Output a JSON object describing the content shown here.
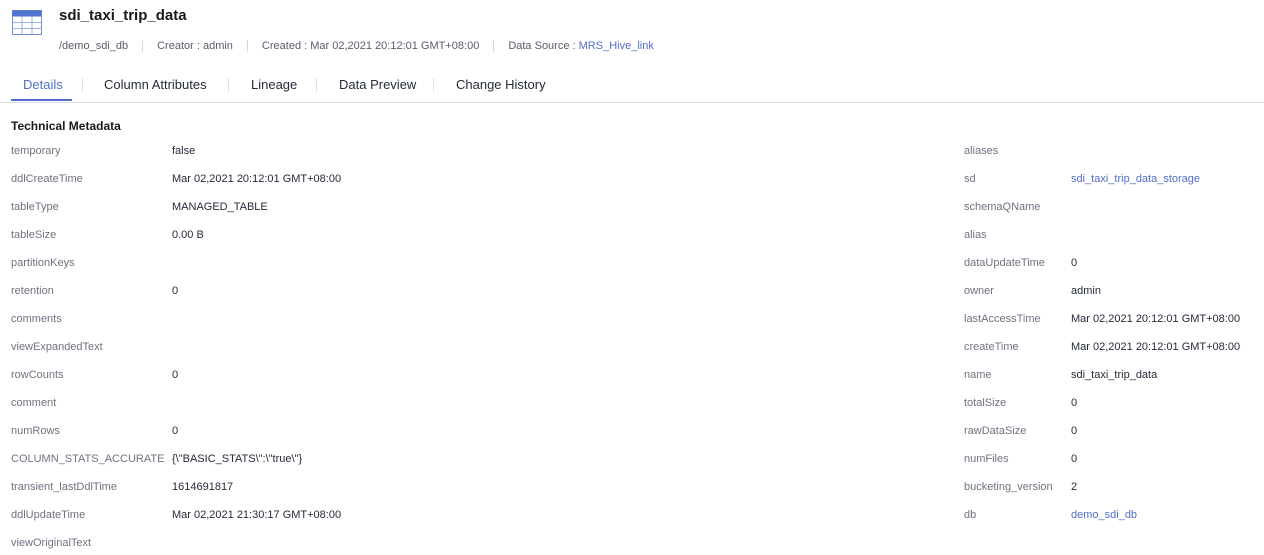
{
  "header": {
    "title": "sdi_taxi_trip_data",
    "path": "/demo_sdi_db",
    "creator": "Creator : admin",
    "created": "Created : Mar 02,2021 20:12:01 GMT+08:00",
    "data_source_label": "Data Source : ",
    "data_source_link": "MRS_Hive_link",
    "icon": "table-icon",
    "accent_color": "#526ecc"
  },
  "tabs": [
    {
      "label": "Details",
      "active": true
    },
    {
      "label": "Column Attributes",
      "active": false
    },
    {
      "label": "Lineage",
      "active": false
    },
    {
      "label": "Data Preview",
      "active": false
    },
    {
      "label": "Change History",
      "active": false
    }
  ],
  "section": {
    "title": "Technical Metadata"
  },
  "left": [
    {
      "key": "temporary",
      "value": "false"
    },
    {
      "key": "ddlCreateTime",
      "value": "Mar 02,2021 20:12:01 GMT+08:00"
    },
    {
      "key": "tableType",
      "value": "MANAGED_TABLE"
    },
    {
      "key": "tableSize",
      "value": "0.00 B"
    },
    {
      "key": "partitionKeys",
      "value": ""
    },
    {
      "key": "retention",
      "value": "0"
    },
    {
      "key": "comments",
      "value": ""
    },
    {
      "key": "viewExpandedText",
      "value": ""
    },
    {
      "key": "rowCounts",
      "value": "0"
    },
    {
      "key": "comment",
      "value": ""
    },
    {
      "key": "numRows",
      "value": "0"
    },
    {
      "key": "COLUMN_STATS_ACCURATE",
      "value": "{\\\"BASIC_STATS\\\":\\\"true\\\"}"
    },
    {
      "key": "transient_lastDdlTime",
      "value": "1614691817"
    },
    {
      "key": "ddlUpdateTime",
      "value": "Mar 02,2021 21:30:17 GMT+08:00"
    },
    {
      "key": "viewOriginalText",
      "value": ""
    }
  ],
  "right": [
    {
      "key": "aliases",
      "value": ""
    },
    {
      "key": "sd",
      "value": "sdi_taxi_trip_data_storage",
      "link": true
    },
    {
      "key": "schemaQName",
      "value": ""
    },
    {
      "key": "alias",
      "value": ""
    },
    {
      "key": "dataUpdateTime",
      "value": "0"
    },
    {
      "key": "owner",
      "value": "admin"
    },
    {
      "key": "lastAccessTime",
      "value": "Mar 02,2021 20:12:01 GMT+08:00"
    },
    {
      "key": "createTime",
      "value": "Mar 02,2021 20:12:01 GMT+08:00"
    },
    {
      "key": "name",
      "value": "sdi_taxi_trip_data"
    },
    {
      "key": "totalSize",
      "value": "0"
    },
    {
      "key": "rawDataSize",
      "value": "0"
    },
    {
      "key": "numFiles",
      "value": "0"
    },
    {
      "key": "bucketing_version",
      "value": "2"
    },
    {
      "key": "db",
      "value": "demo_sdi_db",
      "link": true
    }
  ]
}
